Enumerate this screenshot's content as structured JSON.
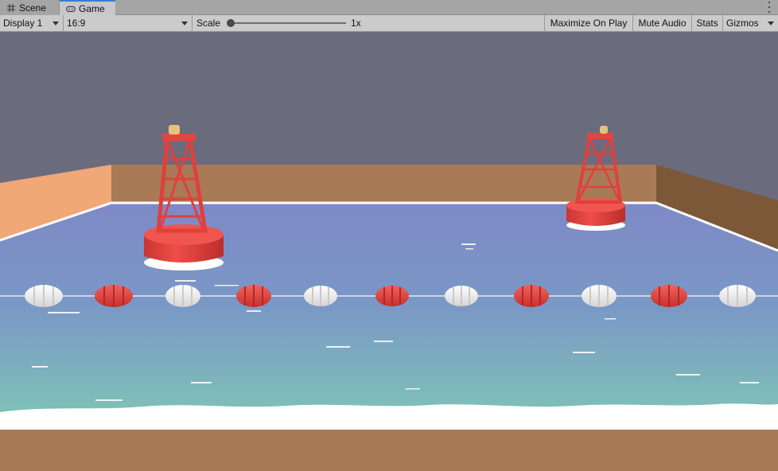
{
  "tabs": [
    {
      "label": "Scene",
      "icon": "grid-icon"
    },
    {
      "label": "Game",
      "icon": "gamepad-icon"
    }
  ],
  "toolbar": {
    "display": "Display 1",
    "aspect": "16:9",
    "scale_label": "Scale",
    "scale_value": "1x",
    "scale_fraction": 0.0,
    "maximize": "Maximize On Play",
    "mute": "Mute Audio",
    "stats": "Stats",
    "gizmos": "Gizmos"
  },
  "colors": {
    "sky": "#6b6b7e",
    "wall": "#a97a56",
    "wall_left": "#f3a878",
    "water_far": "#7f8fc4",
    "water_near": "#7fc4b4",
    "buoy_red": "#e5433f",
    "float_white": "#f1f1f1"
  },
  "scene": {
    "big_buoys": 2,
    "float_pattern": [
      "white",
      "red",
      "white",
      "red",
      "white",
      "red",
      "white",
      "red",
      "white",
      "red",
      "white"
    ]
  }
}
